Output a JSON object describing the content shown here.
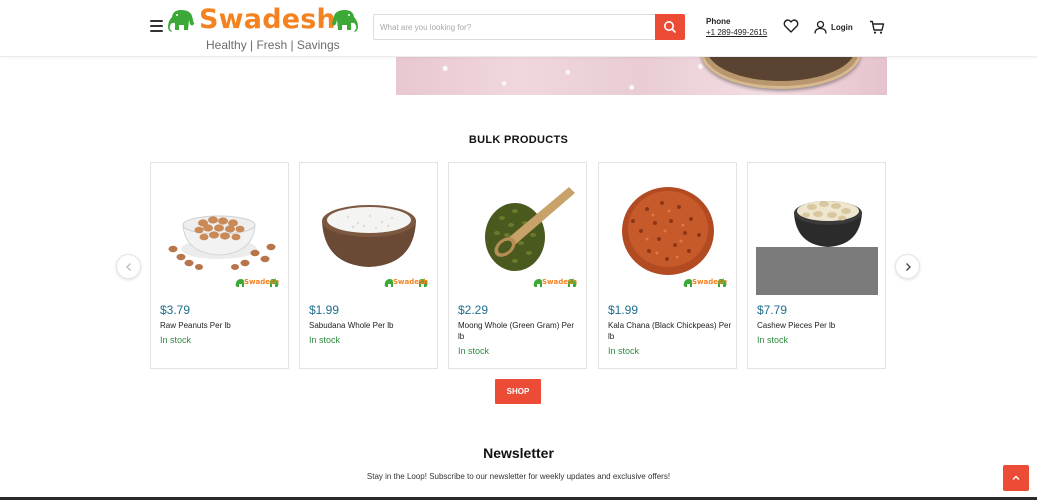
{
  "header": {
    "logo_text": "Swadesh",
    "logo_tagline": "Healthy | Fresh | Savings",
    "search": {
      "placeholder": "What are you looking for?"
    },
    "phone_label": "Phone",
    "phone_number": "+1 289-499-2615",
    "login_label": "Login",
    "icons": [
      "menu-icon",
      "search-icon",
      "heart-icon",
      "user-icon",
      "cart-icon"
    ]
  },
  "bulk": {
    "title": "BULK PRODUCTS",
    "products": [
      {
        "price": "$3.79",
        "name": "Raw Peanuts Per lb",
        "stock": "In stock",
        "watermark": "Swadesh"
      },
      {
        "price": "$1.99",
        "name": "Sabudana Whole Per lb",
        "stock": "In stock",
        "watermark": "Swadesh"
      },
      {
        "price": "$2.29",
        "name": "Moong Whole (Green Gram) Per lb",
        "stock": "In stock",
        "watermark": "Swadesh"
      },
      {
        "price": "$1.99",
        "name": "Kala Chana (Black Chickpeas) Per lb",
        "stock": "In stock",
        "watermark": "Swadesh"
      },
      {
        "price": "$7.79",
        "name": "Cashew Pieces Per lb",
        "stock": "In stock"
      }
    ],
    "shop_label": "SHOP"
  },
  "newsletter": {
    "title": "Newsletter",
    "text": "Stay in the Loop! Subscribe to our newsletter for weekly updates and exclusive offers!"
  },
  "colors": {
    "brand_orange": "#f58220",
    "brand_green": "#3aa935",
    "accent_red": "#ec4b35",
    "price_blue": "#1d6e8e",
    "stock_green": "#2e8b3e"
  }
}
